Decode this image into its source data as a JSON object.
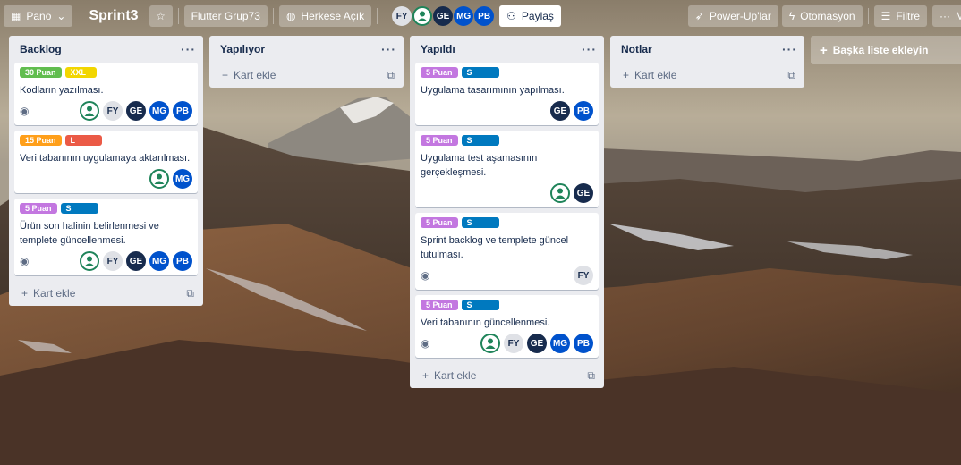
{
  "header": {
    "board_switcher": "Pano",
    "title": "Sprint3",
    "workspace": "Flutter Grup73",
    "visibility": "Herkese Açık",
    "share": "Paylaş",
    "powerups": "Power-Up'lar",
    "automation": "Otomasyon",
    "filter": "Filtre",
    "more": "M",
    "members": [
      "FY",
      "GE",
      "MG",
      "PB"
    ]
  },
  "lists": [
    {
      "title": "Backlog",
      "add_card": "Kart ekle",
      "cards": [
        {
          "labels": [
            {
              "text": "30 Puan",
              "color": "#61bd4f"
            },
            {
              "text": "XXL",
              "color": "#f2d600"
            }
          ],
          "title": "Kodların yazılması.",
          "watch": true,
          "members": [
            "user",
            "FY",
            "GE",
            "MG",
            "PB"
          ]
        },
        {
          "labels": [
            {
              "text": "15 Puan",
              "color": "#ff9f1a"
            },
            {
              "text": "L",
              "color": "#eb5a46"
            }
          ],
          "title": "Veri tabanının uygulamaya aktarılması.",
          "watch": false,
          "members": [
            "user",
            "MG"
          ]
        },
        {
          "labels": [
            {
              "text": "5 Puan",
              "color": "#c377e0"
            },
            {
              "text": "S",
              "color": "#0079bf"
            }
          ],
          "title": "Ürün son halinin belirlenmesi ve templete güncellenmesi.",
          "watch": true,
          "members": [
            "user",
            "FY",
            "GE",
            "MG",
            "PB"
          ]
        }
      ]
    },
    {
      "title": "Yapılıyor",
      "add_card": "Kart ekle",
      "cards": []
    },
    {
      "title": "Yapıldı",
      "add_card": "Kart ekle",
      "cards": [
        {
          "labels": [
            {
              "text": "5 Puan",
              "color": "#c377e0"
            },
            {
              "text": "S",
              "color": "#0079bf"
            }
          ],
          "title": "Uygulama tasarımının yapılması.",
          "watch": false,
          "members": [
            "GE",
            "PB"
          ]
        },
        {
          "labels": [
            {
              "text": "5 Puan",
              "color": "#c377e0"
            },
            {
              "text": "S",
              "color": "#0079bf"
            }
          ],
          "title": "Uygulama test aşamasının gerçekleşmesi.",
          "watch": false,
          "members": [
            "user",
            "GE"
          ]
        },
        {
          "labels": [
            {
              "text": "5 Puan",
              "color": "#c377e0"
            },
            {
              "text": "S",
              "color": "#0079bf"
            }
          ],
          "title": "Sprint backlog ve templete güncel tutulması.",
          "watch": true,
          "members": [
            "FY"
          ]
        },
        {
          "labels": [
            {
              "text": "5 Puan",
              "color": "#c377e0"
            },
            {
              "text": "S",
              "color": "#0079bf"
            }
          ],
          "title": "Veri tabanının güncellenmesi.",
          "watch": true,
          "members": [
            "user",
            "FY",
            "GE",
            "MG",
            "PB"
          ]
        }
      ]
    },
    {
      "title": "Notlar",
      "add_card": "Kart ekle",
      "cards": []
    }
  ],
  "add_list": "Başka liste ekleyin"
}
